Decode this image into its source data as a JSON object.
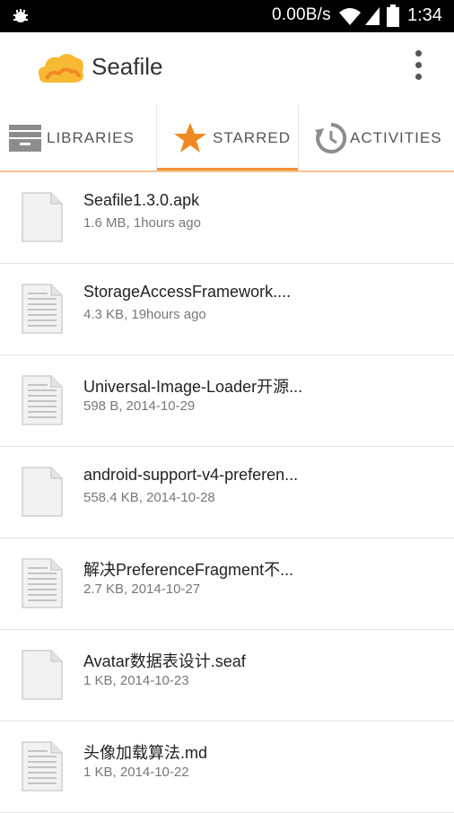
{
  "status_bar": {
    "net_speed": "0.00B/s",
    "time": "1:34"
  },
  "app_bar": {
    "title": "Seafile"
  },
  "tabs": [
    {
      "label": "LIBRARIES",
      "icon": "archive-icon",
      "selected": false
    },
    {
      "label": "STARRED",
      "icon": "star-icon",
      "selected": true
    },
    {
      "label": "ACTIVITIES",
      "icon": "history-icon",
      "selected": false
    }
  ],
  "colors": {
    "accent": "#f49133",
    "star": "#f08a24"
  },
  "files": [
    {
      "name": "Seafile1.3.0.apk",
      "meta": "1.6 MB, 1hours ago",
      "icon": "blank-file-icon"
    },
    {
      "name": "StorageAccessFramework....",
      "meta": "4.3 KB, 19hours ago",
      "icon": "text-file-icon"
    },
    {
      "name": "Universal-Image-Loader开源...",
      "meta": "598 B, 2014-10-29",
      "icon": "text-file-icon"
    },
    {
      "name": "android-support-v4-preferen...",
      "meta": "558.4 KB, 2014-10-28",
      "icon": "blank-file-icon"
    },
    {
      "name": "解决PreferenceFragment不...",
      "meta": "2.7 KB, 2014-10-27",
      "icon": "text-file-icon"
    },
    {
      "name": "Avatar数据表设计.seaf",
      "meta": "1 KB, 2014-10-23",
      "icon": "blank-file-icon"
    },
    {
      "name": "头像加载算法.md",
      "meta": "1 KB, 2014-10-22",
      "icon": "text-file-icon"
    }
  ]
}
